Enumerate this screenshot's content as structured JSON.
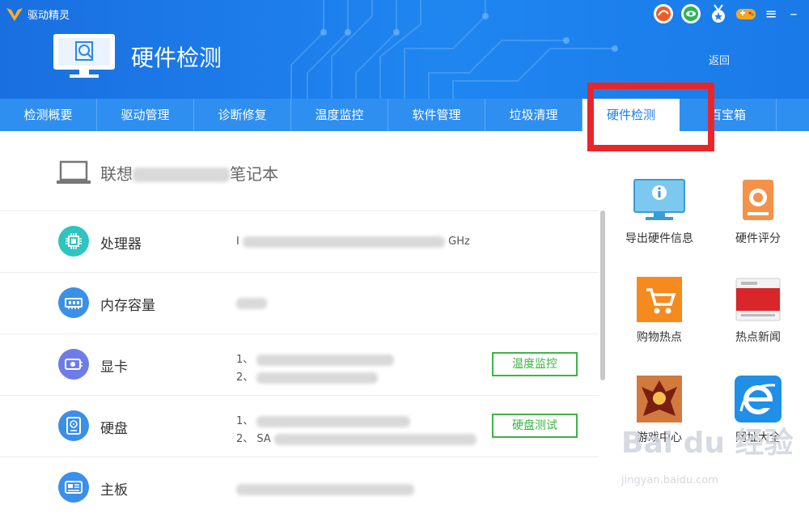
{
  "app": {
    "name": "驱动精灵"
  },
  "header": {
    "title": "硬件检测",
    "back": "返回"
  },
  "top_icons": [
    "speed-icon",
    "eye-icon",
    "medal-icon",
    "gamepad-icon"
  ],
  "window_controls": {
    "menu": "≡",
    "minimize": "–"
  },
  "tabs": [
    {
      "label": "检测概要"
    },
    {
      "label": "驱动管理"
    },
    {
      "label": "诊断修复"
    },
    {
      "label": "温度监控"
    },
    {
      "label": "软件管理"
    },
    {
      "label": "垃圾清理"
    },
    {
      "label": "硬件检测",
      "active": true
    },
    {
      "label": "百宝箱"
    }
  ],
  "device": {
    "name_start": "联想",
    "name_end": "笔记本"
  },
  "hardware": [
    {
      "label": "处理器",
      "value_prefix": "I",
      "value_suffix": "GHz"
    },
    {
      "label": "内存容量"
    },
    {
      "label": "显卡",
      "line1": "1、",
      "line2": "2、",
      "button": "温度监控"
    },
    {
      "label": "硬盘",
      "line1": "1、",
      "line2": "2、 SA",
      "button": "硬盘测试"
    },
    {
      "label": "主板"
    }
  ],
  "side_tools": [
    {
      "label": "导出硬件信息",
      "icon": "monitor-info-icon"
    },
    {
      "label": "硬件评分",
      "icon": "score-icon"
    },
    {
      "label": "购物热点",
      "icon": "cart-icon"
    },
    {
      "label": "热点新闻",
      "icon": "news-icon"
    },
    {
      "label": "游戏中心",
      "icon": "game-icon"
    },
    {
      "label": "网址大全",
      "icon": "ie-icon"
    }
  ],
  "watermark": {
    "main": "Bai du 经验",
    "url": "jingyan.baidu.com"
  },
  "colors": {
    "header": "#1f86f0",
    "tabbar": "#2f8ff0",
    "accent": "#1f7de6",
    "green": "#3cb447",
    "highlight": "#e8262a"
  }
}
